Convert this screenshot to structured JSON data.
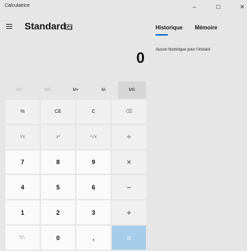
{
  "app": {
    "title": "Calculatrice"
  },
  "window_controls": {
    "minimize": "–",
    "maximize": "☐",
    "close": "✕"
  },
  "header": {
    "mode": "Standard"
  },
  "display": {
    "value": "0"
  },
  "memory": [
    {
      "label": "MC",
      "state": "disabled"
    },
    {
      "label": "MR",
      "state": "disabled"
    },
    {
      "label": "M+",
      "state": "enabled"
    },
    {
      "label": "M-",
      "state": "enabled"
    },
    {
      "label": "MS",
      "state": "active"
    }
  ],
  "keypad": {
    "percent": "%",
    "ce": "CE",
    "clear": "C",
    "backspace": "⌫",
    "reciprocal": "¹⁄x",
    "square": "x²",
    "sqrt": "²√x",
    "divide": "÷",
    "n7": "7",
    "n8": "8",
    "n9": "9",
    "multiply": "×",
    "n4": "4",
    "n5": "5",
    "n6": "6",
    "minus": "−",
    "n1": "1",
    "n2": "2",
    "n3": "3",
    "plus": "+",
    "negate": "⁺∕₋",
    "n0": "0",
    "decimal": ",",
    "equals": "="
  },
  "side_panel": {
    "tabs": [
      "Historique",
      "Mémoire"
    ],
    "empty_message": "Aucun historique pour l'instant"
  },
  "colors": {
    "accent": "#0067c0",
    "equals": "#a6cdea",
    "background": "#e6e6e6"
  }
}
